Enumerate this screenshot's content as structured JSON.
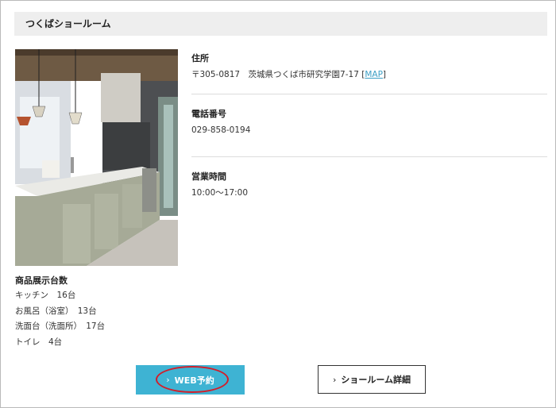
{
  "showroom": {
    "name": "つくばショールーム",
    "address_label": "住所",
    "address_value": "〒305-0817　茨城県つくば市研究学園7-17",
    "map_link": "MAP",
    "phone_label": "電話番号",
    "phone_value": "029-858-0194",
    "hours_label": "営業時間",
    "hours_value": "10:00〜17:00"
  },
  "display": {
    "title": "商品展示台数",
    "items": [
      "キッチン　16台",
      "お風呂（浴室）　13台",
      "洗面台（洗面所）　17台",
      "トイレ　4台"
    ]
  },
  "buttons": {
    "web_reserve": "WEB予約",
    "showroom_detail": "ショールーム詳細",
    "chevron": "›"
  },
  "colors": {
    "accent": "#3eb3d3",
    "highlight_oval": "#d21e2a",
    "link": "#3b9ec4"
  }
}
